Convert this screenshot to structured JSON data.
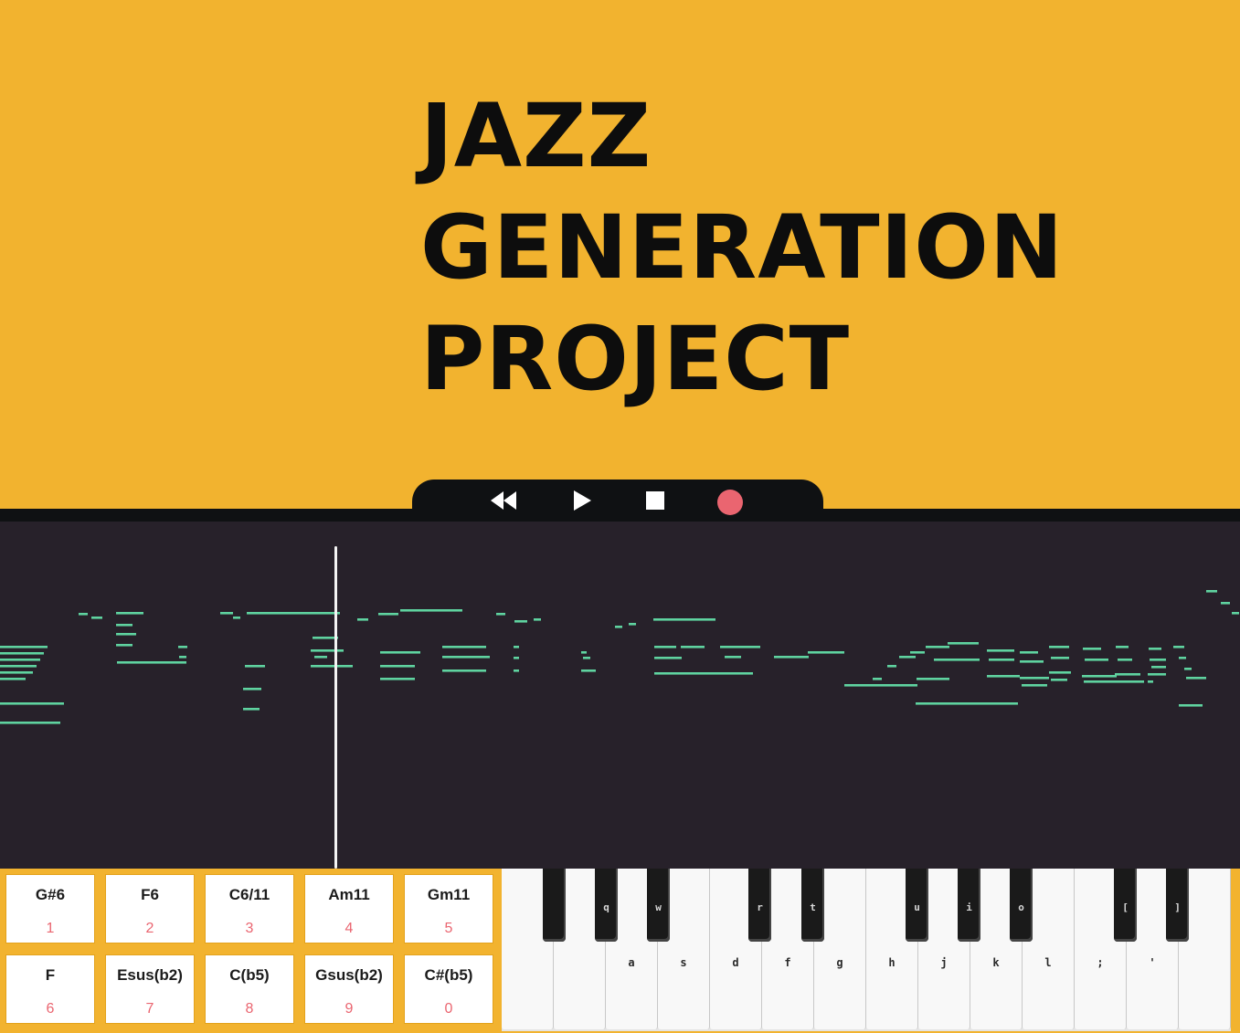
{
  "title": {
    "line1": "JAZZ",
    "line2": "GENERATION",
    "line3": "PROJECT"
  },
  "colors": {
    "background": "#f2b32f",
    "transport_bar": "#0f1113",
    "roll_background": "#27212a",
    "note": "#5fd3a0",
    "record": "#ea6570",
    "pad_number": "#ea6570"
  },
  "transport": {
    "rewind_icon": "rewind-icon",
    "play_icon": "play-icon",
    "stop_icon": "stop-icon",
    "record_icon": "record-icon"
  },
  "chord_pads": [
    {
      "chord": "G#6",
      "key": "1"
    },
    {
      "chord": "F6",
      "key": "2"
    },
    {
      "chord": "C6/11",
      "key": "3"
    },
    {
      "chord": "Am11",
      "key": "4"
    },
    {
      "chord": "Gm11",
      "key": "5"
    },
    {
      "chord": "F",
      "key": "6"
    },
    {
      "chord": "Esus(b2)",
      "key": "7"
    },
    {
      "chord": "C(b5)",
      "key": "8"
    },
    {
      "chord": "Gsus(b2)",
      "key": "9"
    },
    {
      "chord": "C#(b5)",
      "key": "0"
    }
  ],
  "keyboard": {
    "white_key_labels": [
      "",
      "",
      "a",
      "s",
      "d",
      "f",
      "g",
      "h",
      "j",
      "k",
      "l",
      ";",
      "'",
      ""
    ],
    "black_key_labels": [
      "",
      "q",
      "w",
      "r",
      "t",
      "u",
      "i",
      "o",
      "[",
      "]"
    ]
  }
}
